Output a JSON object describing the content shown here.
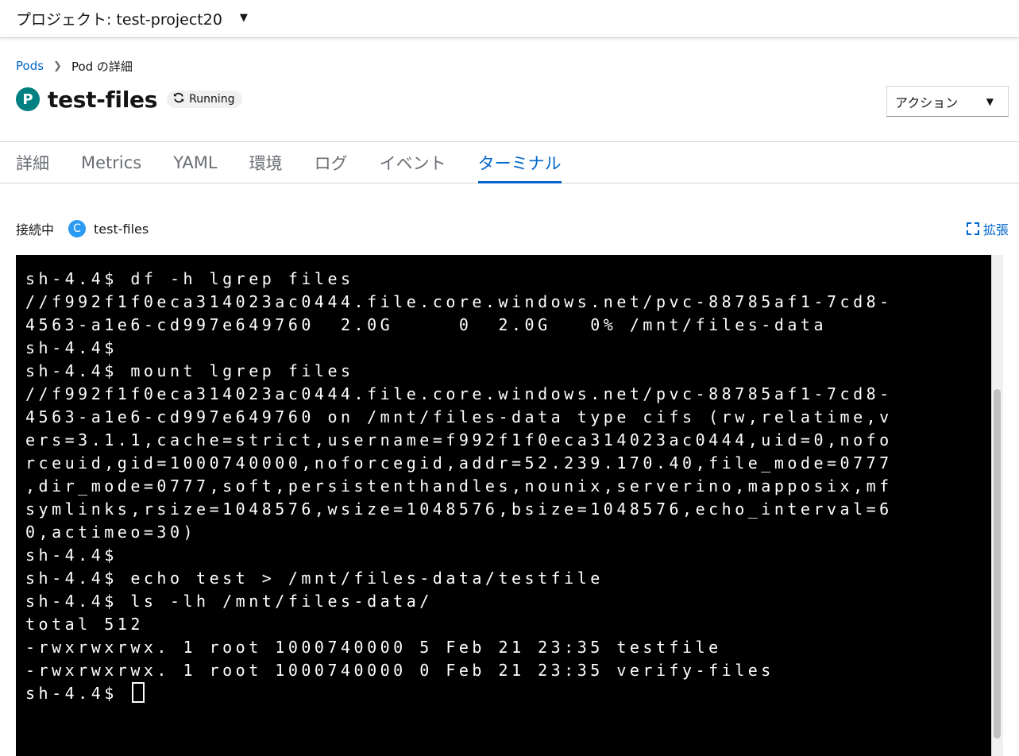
{
  "project": {
    "label": "プロジェクト: test-project20"
  },
  "breadcrumb": {
    "parent": "Pods",
    "current": "Pod の詳細"
  },
  "resource": {
    "badge": "P",
    "name": "test-files",
    "status": "Running"
  },
  "actions": {
    "label": "アクション"
  },
  "tabs": [
    {
      "label": "詳細"
    },
    {
      "label": "Metrics"
    },
    {
      "label": "YAML"
    },
    {
      "label": "環境"
    },
    {
      "label": "ログ"
    },
    {
      "label": "イベント"
    },
    {
      "label": "ターミナル"
    }
  ],
  "connection": {
    "label": "接続中",
    "badge": "C",
    "container": "test-files",
    "expand_label": "拡張"
  },
  "terminal": {
    "lines": [
      "sh-4.4$ df -h lgrep files",
      "//f992f1f0eca314023ac0444.file.core.windows.net/pvc-88785af1-7cd8-",
      "4563-a1e6-cd997e649760  2.0G     0  2.0G   0% /mnt/files-data",
      "sh-4.4$",
      "sh-4.4$ mount lgrep files",
      "//f992f1f0eca314023ac0444.file.core.windows.net/pvc-88785af1-7cd8-",
      "4563-a1e6-cd997e649760 on /mnt/files-data type cifs (rw,relatime,v",
      "ers=3.1.1,cache=strict,username=f992f1f0eca314023ac0444,uid=0,nofo",
      "rceuid,gid=1000740000,noforcegid,addr=52.239.170.40,file_mode=0777",
      ",dir_mode=0777,soft,persistenthandles,nounix,serverino,mapposix,mf",
      "symlinks,rsize=1048576,wsize=1048576,bsize=1048576,echo_interval=6",
      "0,actimeo=30)",
      "sh-4.4$",
      "sh-4.4$ echo test > /mnt/files-data/testfile",
      "sh-4.4$ ls -lh /mnt/files-data/",
      "total 512",
      "-rwxrwxrwx. 1 root 1000740000 5 Feb 21 23:35 testfile",
      "-rwxrwxrwx. 1 root 1000740000 0 Feb 21 23:35 verify-files"
    ],
    "prompt": "sh-4.4$ "
  },
  "colors": {
    "accent": "#0066cc",
    "pod_badge": "#008080",
    "container_badge": "#2b9af3",
    "terminal_bg": "#000000"
  },
  "icons": {
    "project_caret": "caret-down-icon",
    "breadcrumb_separator": "chevron-right-icon",
    "status": "sync-icon",
    "actions_caret": "caret-down-icon",
    "expand": "expand-icon"
  }
}
